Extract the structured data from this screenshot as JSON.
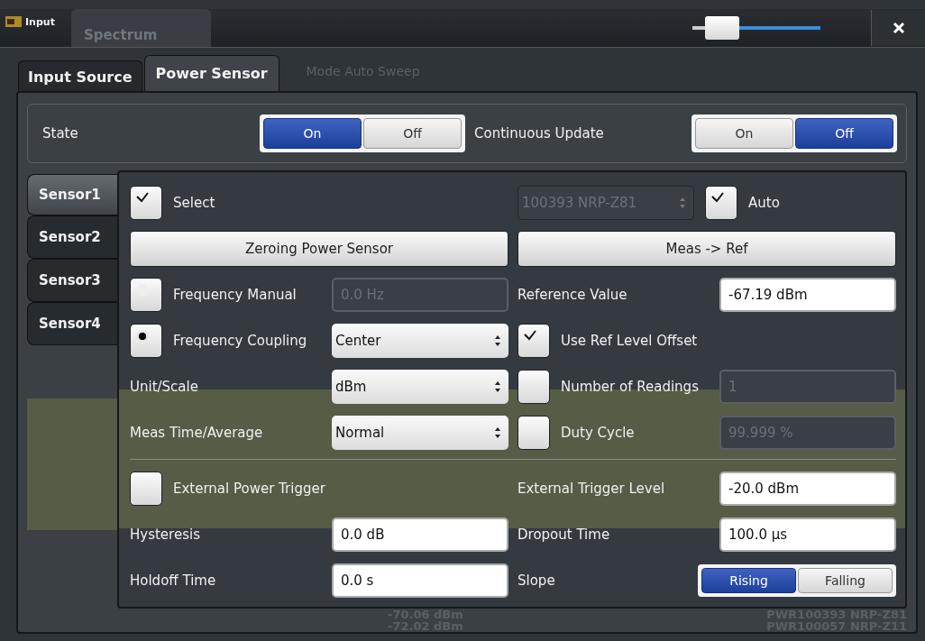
{
  "window": {
    "title": "Input",
    "background_tab": "Spectrum",
    "slider": {
      "level": 0.1
    }
  },
  "tabs": [
    {
      "label": "Input Source",
      "selected": false
    },
    {
      "label": "Power Sensor",
      "selected": true
    }
  ],
  "background_status": "Mode Auto Sweep",
  "state_group": {
    "items": [
      {
        "label": "State",
        "options": [
          {
            "label": "On",
            "selected": true
          },
          {
            "label": "Off",
            "selected": false
          }
        ]
      },
      {
        "label": "Continuous Update",
        "options": [
          {
            "label": "On",
            "selected": false
          },
          {
            "label": "Off",
            "selected": true
          }
        ]
      }
    ]
  },
  "sensor_tabs": [
    {
      "label": "Sensor1",
      "selected": true
    },
    {
      "label": "Sensor2",
      "selected": false
    },
    {
      "label": "Sensor3",
      "selected": false
    },
    {
      "label": "Sensor4",
      "selected": false
    }
  ],
  "sensor": {
    "select": {
      "label": "Select",
      "checked": true
    },
    "device": {
      "value": "100393 NRP-Z81",
      "disabled": true
    },
    "auto": {
      "label": "Auto",
      "checked": true
    },
    "buttons": [
      "Zeroing Power Sensor",
      "Meas -> Ref"
    ],
    "sections": [
      {
        "rows": [
          {
            "left": {
              "kind": "radio-field",
              "label": "Frequency Manual",
              "selected": false,
              "value": "0.0 Hz",
              "disabled": true
            },
            "right": {
              "kind": "label-field",
              "label": "Reference Value",
              "value": "-67.19 dBm",
              "disabled": false
            }
          },
          {
            "left": {
              "kind": "radio-select",
              "label": "Frequency Coupling",
              "selected": true,
              "value": "Center"
            },
            "right": {
              "kind": "checkbox",
              "label": "Use Ref Level Offset",
              "checked": true
            }
          },
          {
            "left": {
              "kind": "label-select",
              "label": "Unit/Scale",
              "value": "dBm"
            },
            "right": {
              "kind": "checkbox-field",
              "label": "Number of Readings",
              "checked": false,
              "value": "1",
              "disabled": true
            }
          },
          {
            "left": {
              "kind": "label-select",
              "label": "Meas Time/Average",
              "value": "Normal"
            },
            "right": {
              "kind": "checkbox-field",
              "label": "Duty Cycle",
              "checked": false,
              "value": "99.999 %",
              "disabled": true
            }
          }
        ]
      },
      {
        "rows": [
          {
            "left": {
              "kind": "checkbox",
              "label": "External Power Trigger",
              "checked": false
            },
            "right": {
              "kind": "label-field",
              "label": "External Trigger Level",
              "value": "-20.0 dBm",
              "disabled": false
            }
          },
          {
            "left": {
              "kind": "label-field",
              "label": "Hysteresis",
              "value": "0.0 dB",
              "disabled": false
            },
            "right": {
              "kind": "label-field",
              "label": "Dropout Time",
              "value": "100.0 µs",
              "disabled": false
            }
          },
          {
            "left": {
              "kind": "label-field",
              "label": "Holdoff Time",
              "value": "0.0 s",
              "disabled": false
            },
            "right": {
              "kind": "label-toggle",
              "label": "Slope",
              "options": [
                {
                  "label": "Rising",
                  "selected": true
                },
                {
                  "label": "Falling",
                  "selected": false
                }
              ]
            }
          }
        ]
      }
    ]
  },
  "background_readout": {
    "values": [
      "-70.06 dBm",
      "-72.02 dBm"
    ],
    "sensors": [
      "PWR100393 NRP-Z81",
      "PWR100057 NRP-Z11"
    ]
  }
}
